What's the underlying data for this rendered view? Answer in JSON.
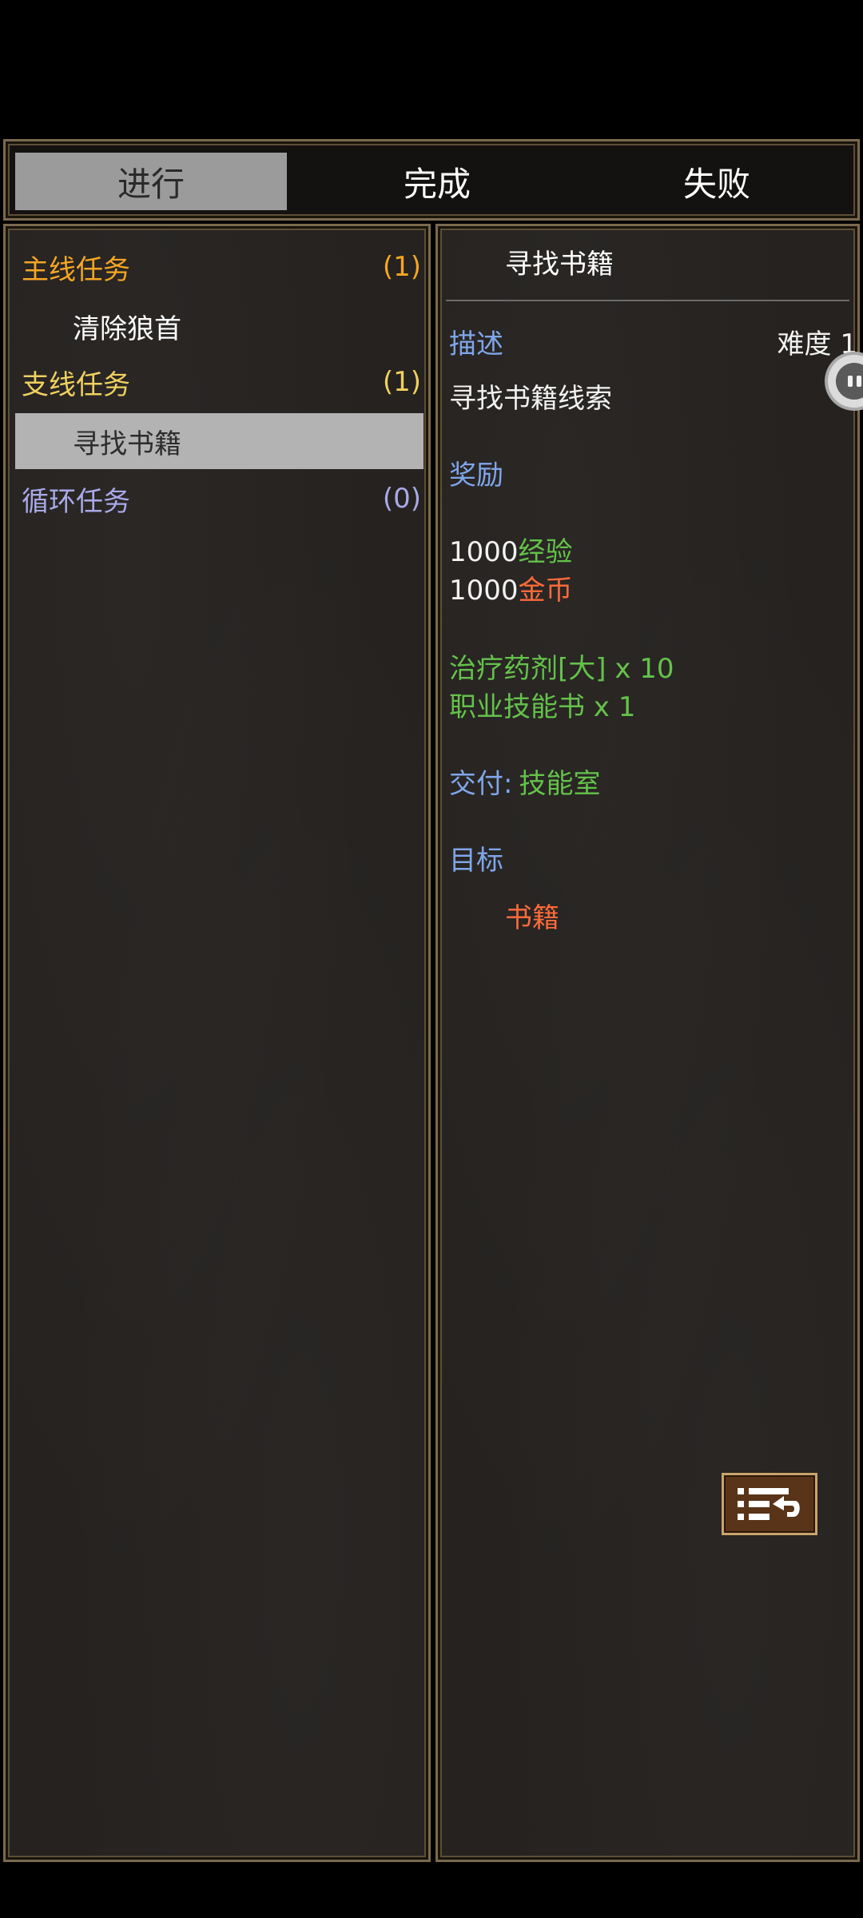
{
  "tabs": [
    {
      "label": "进行",
      "active": true
    },
    {
      "label": "完成",
      "active": false
    },
    {
      "label": "失败",
      "active": false
    }
  ],
  "categories": [
    {
      "label": "主线任务",
      "count": "(1)",
      "color": "#f5a623"
    },
    {
      "label": "支线任务",
      "count": "(1)",
      "color": "#f0d060"
    },
    {
      "label": "循环任务",
      "count": "(0)",
      "color": "#a9a9e8"
    }
  ],
  "quests": [
    {
      "label": "清除狼首",
      "selected": false
    },
    {
      "label": "寻找书籍",
      "selected": true
    }
  ],
  "detail": {
    "title": "寻找书籍",
    "description_label": "描述",
    "difficulty": "难度 1",
    "description": "寻找书籍线索",
    "reward_label": "奖励",
    "reward_exp_amount": "1000",
    "reward_exp_label": "经验",
    "reward_gold_amount": "1000",
    "reward_gold_label": "金币",
    "item_1": "治疗药剂[大] x 10",
    "item_2": "职业技能书 x 1",
    "deliver_label": "交付:",
    "deliver_target": "技能室",
    "goal_label": "目标",
    "goal_item": "书籍"
  },
  "icons": {
    "float_button": "assistive-menu-icon",
    "action_button": "quest-track-icon"
  }
}
